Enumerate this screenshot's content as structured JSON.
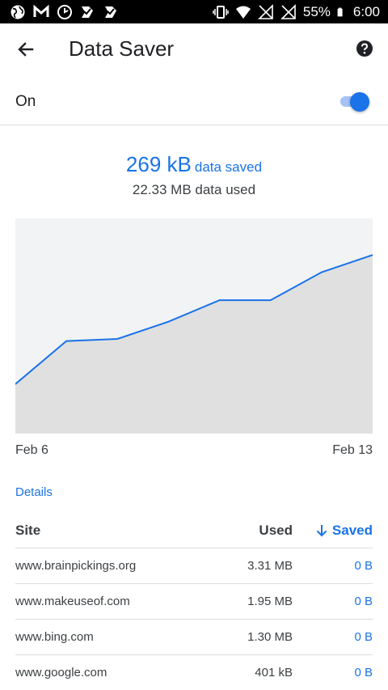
{
  "status_bar": {
    "battery_percent": "55%",
    "time": "6:00",
    "left_icons": [
      "globe-icon",
      "gmail-icon",
      "clock-icon",
      "tasks-icon",
      "tasks-icon"
    ],
    "right_icons": [
      "vibrate-icon",
      "wifi-icon",
      "no-signal-icon",
      "no-signal-icon",
      "battery-icon"
    ]
  },
  "toolbar": {
    "title": "Data Saver",
    "back_icon": "arrow-back-icon",
    "help_icon": "help-icon"
  },
  "toggle_row": {
    "label": "On",
    "enabled": true
  },
  "summary": {
    "saved_amount": "269 kB",
    "saved_suffix": "data saved",
    "used_text": "22.33 MB data used"
  },
  "chart_data": {
    "type": "area",
    "x": [
      "Feb 6",
      "Feb 7",
      "Feb 8",
      "Feb 9",
      "Feb 10",
      "Feb 11",
      "Feb 12",
      "Feb 13"
    ],
    "series": [
      {
        "values": [
          0.23,
          0.43,
          0.44,
          0.52,
          0.62,
          0.62,
          0.75,
          0.83
        ]
      }
    ],
    "ylim": [
      0,
      1
    ],
    "x_start_label": "Feb 6",
    "x_end_label": "Feb 13",
    "colors": {
      "line": "#1a73e8",
      "fill": "#e0e0e0",
      "background": "#f1f3f4"
    }
  },
  "details_link": "Details",
  "table": {
    "headers": {
      "site": "Site",
      "used": "Used",
      "saved": "Saved"
    },
    "sort_icon": "arrow-down-icon",
    "rows": [
      {
        "site": "www.brainpickings.org",
        "used": "3.31 MB",
        "saved": "0 B"
      },
      {
        "site": "www.makeuseof.com",
        "used": "1.95 MB",
        "saved": "0 B"
      },
      {
        "site": "www.bing.com",
        "used": "1.30 MB",
        "saved": "0 B"
      },
      {
        "site": "www.google.com",
        "used": "401 kB",
        "saved": "0 B"
      }
    ]
  },
  "colors": {
    "accent": "#1a73e8",
    "text_primary": "#202124",
    "divider": "#dadce0"
  }
}
